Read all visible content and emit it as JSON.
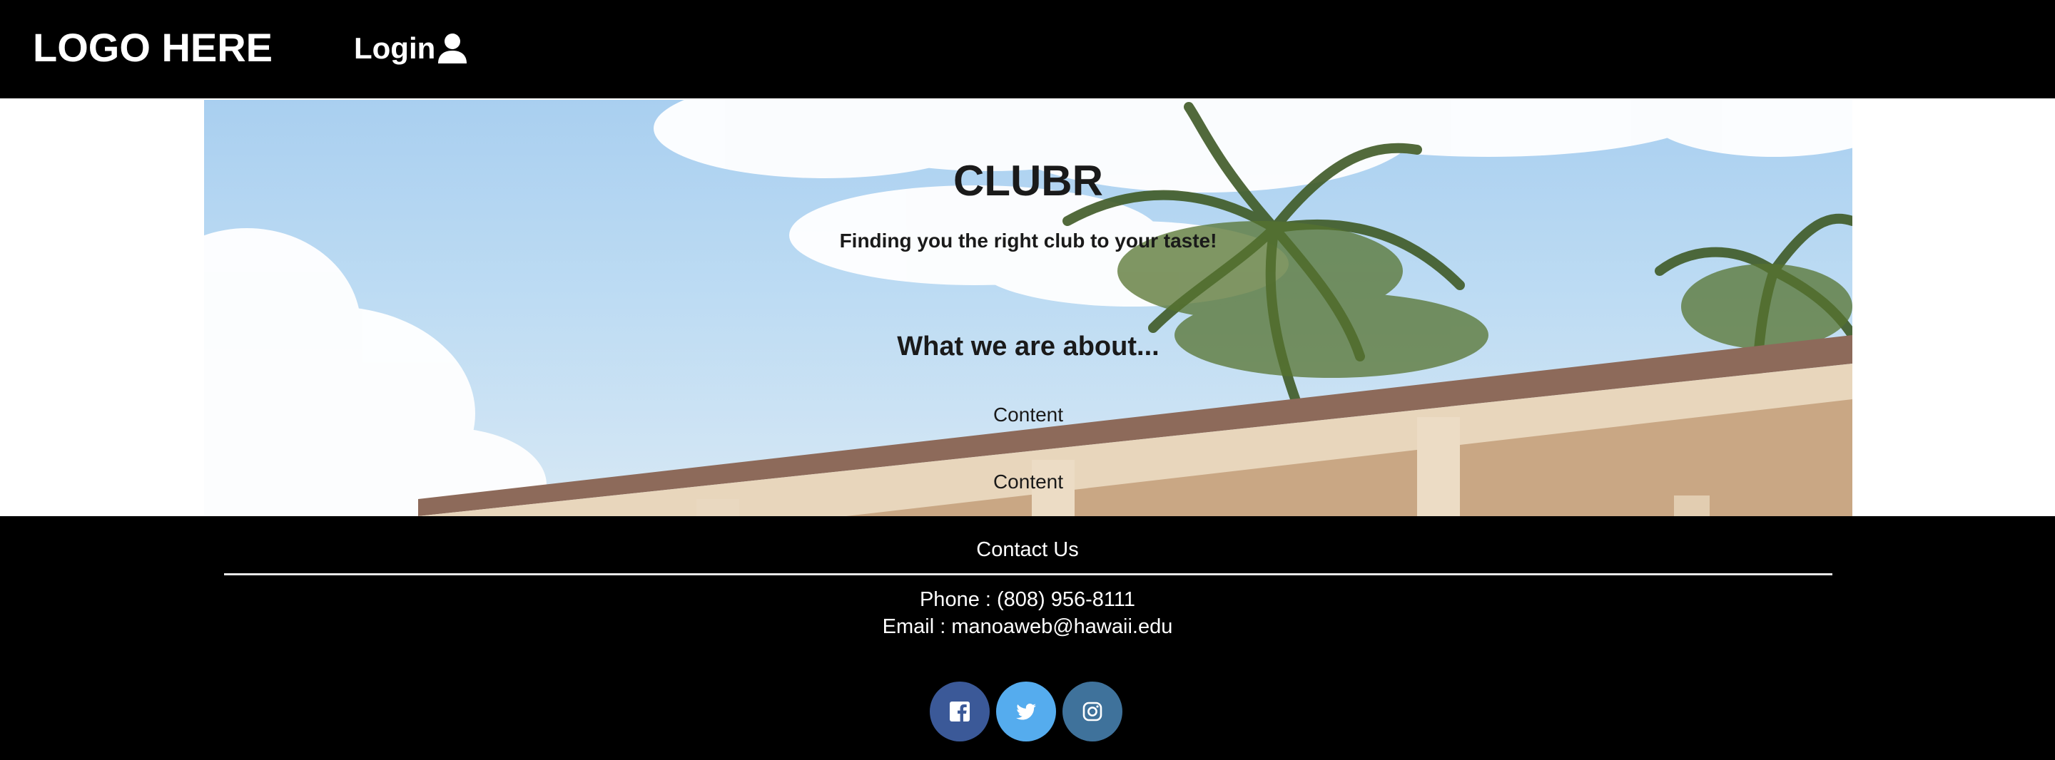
{
  "navbar": {
    "logo": "LOGO HERE",
    "login_label": "Login",
    "login_icon": "user-icon"
  },
  "hero": {
    "title": "CLUBR",
    "subtitle": "Finding you the right club to your taste!",
    "about_heading": "What we are about...",
    "content_1": "Content",
    "content_2": "Content"
  },
  "footer": {
    "title": "Contact Us",
    "phone": "Phone : (808) 956-8111",
    "email": "Email : manoaweb@hawaii.edu",
    "socials": [
      {
        "icon": "facebook-icon",
        "color": "#3b5998"
      },
      {
        "icon": "twitter-icon",
        "color": "#55acee"
      },
      {
        "icon": "instagram-icon",
        "color": "#3f729b"
      }
    ]
  },
  "colors": {
    "nav_bg": "#000000",
    "footer_bg": "#000000",
    "text_light": "#ffffff",
    "text_dark": "#1a1a1a"
  }
}
